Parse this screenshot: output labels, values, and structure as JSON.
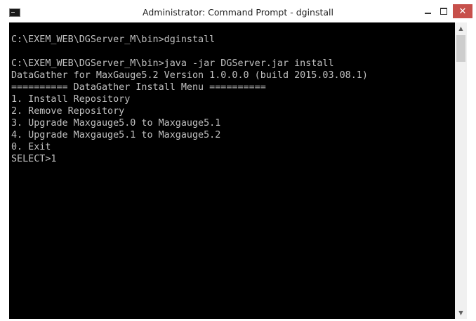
{
  "window": {
    "title": "Administrator: Command Prompt - dginstall",
    "controls": {
      "minimize": "minimize",
      "maximize": "maximize",
      "close": "✕"
    }
  },
  "console": {
    "lines": [
      "C:\\EXEM_WEB\\DGServer_M\\bin>dginstall",
      "",
      "C:\\EXEM_WEB\\DGServer_M\\bin>java -jar DGServer.jar install",
      "DataGather for MaxGauge5.2 Version 1.0.0.0 (build 2015.03.08.1)",
      "========== DataGather Install Menu ==========",
      "1. Install Repository",
      "2. Remove Repository",
      "3. Upgrade Maxgauge5.0 to Maxgauge5.1",
      "4. Upgrade Maxgauge5.1 to Maxgauge5.2",
      "0. Exit",
      "SELECT>1"
    ]
  },
  "colors": {
    "console_background": "#000000",
    "console_text": "#c0c0c0",
    "close_button": "#c7504b"
  },
  "icons": {
    "app": "command-prompt-icon",
    "scroll_up": "▲",
    "scroll_down": "▼"
  }
}
